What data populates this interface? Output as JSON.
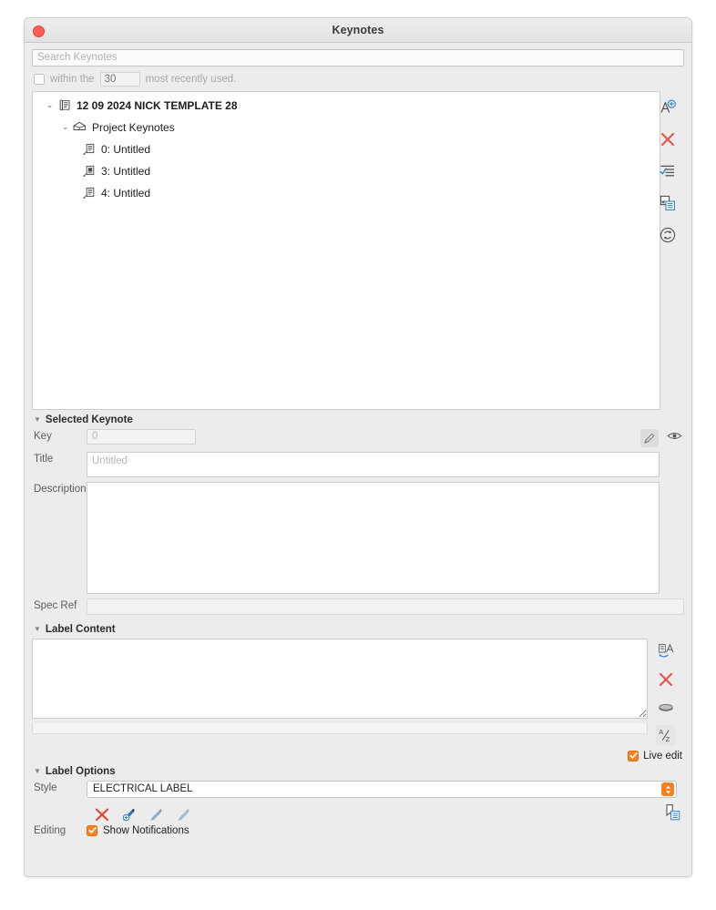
{
  "window": {
    "title": "Keynotes",
    "close_label": "Close"
  },
  "search": {
    "placeholder": "Search Keynotes",
    "value": ""
  },
  "mru": {
    "checked": false,
    "prefix_label": "within the",
    "count_value": "30",
    "suffix_label": "most recently used."
  },
  "tree": {
    "items": [
      {
        "level": 0,
        "twisty": "⌄",
        "icon": "keynote-file-icon",
        "label": "12 09 2024 NICK TEMPLATE 28"
      },
      {
        "level": 1,
        "twisty": "⌄",
        "icon": "project-keynotes-house-icon",
        "label": "Project Keynotes"
      },
      {
        "level": 2,
        "twisty": "",
        "icon": "keynote-leader-icon",
        "label": "0: Untitled"
      },
      {
        "level": 2,
        "twisty": "",
        "icon": "keynote-leader-filled-icon",
        "label": "3: Untitled"
      },
      {
        "level": 2,
        "twisty": "",
        "icon": "keynote-leader-icon",
        "label": "4: Untitled"
      }
    ],
    "tools": [
      {
        "name": "add-keynote-icon",
        "title": "Add Keynote"
      },
      {
        "name": "delete-keynote-icon",
        "title": "Delete Keynote"
      },
      {
        "name": "edit-list-icon",
        "title": "Edit List"
      },
      {
        "name": "duplicate-icon",
        "title": "Duplicate"
      },
      {
        "name": "reload-icon",
        "title": "Reload"
      }
    ]
  },
  "selected_keynote": {
    "section_title": "Selected Keynote",
    "key_label": "Key",
    "key_value": "",
    "key_placeholder": "0",
    "title_label": "Title",
    "title_value": "",
    "title_placeholder": "Untitled",
    "description_label": "Description",
    "description_value": "",
    "spec_ref_label": "Spec Ref",
    "spec_ref_value": "",
    "edit_icon": "pencil-icon",
    "visibility_icon": "eye-icon"
  },
  "label_content": {
    "section_title": "Label Content",
    "value": "",
    "tools": [
      {
        "name": "text-refresh-icon",
        "title": "Refresh Text"
      },
      {
        "name": "clear-icon",
        "title": "Clear"
      },
      {
        "name": "ellipse-icon",
        "title": "Shape"
      },
      {
        "name": "sort-az-icon",
        "title": "Sort A-Z"
      }
    ],
    "live_edit_label": "Live edit",
    "live_edit_checked": true
  },
  "label_options": {
    "section_title": "Label Options",
    "style_label": "Style",
    "style_value": "ELECTRICAL LABEL",
    "editing_label": "Editing",
    "show_notifications_label": "Show Notifications",
    "show_notifications_checked": true,
    "edit_icons": [
      {
        "name": "remove-style-icon",
        "title": "Remove"
      },
      {
        "name": "eyedropper-add-icon",
        "title": "Add Style"
      },
      {
        "name": "eyedropper-match-icon",
        "title": "Match Style"
      },
      {
        "name": "eyedropper-apply-icon",
        "title": "Apply Style"
      }
    ],
    "bookmark_icon": "bookmark-list-icon"
  },
  "colors": {
    "accent_orange": "#f5821f",
    "delete_red": "#e8584a",
    "blue": "#2f7fd0",
    "window_bg": "#ececec"
  }
}
